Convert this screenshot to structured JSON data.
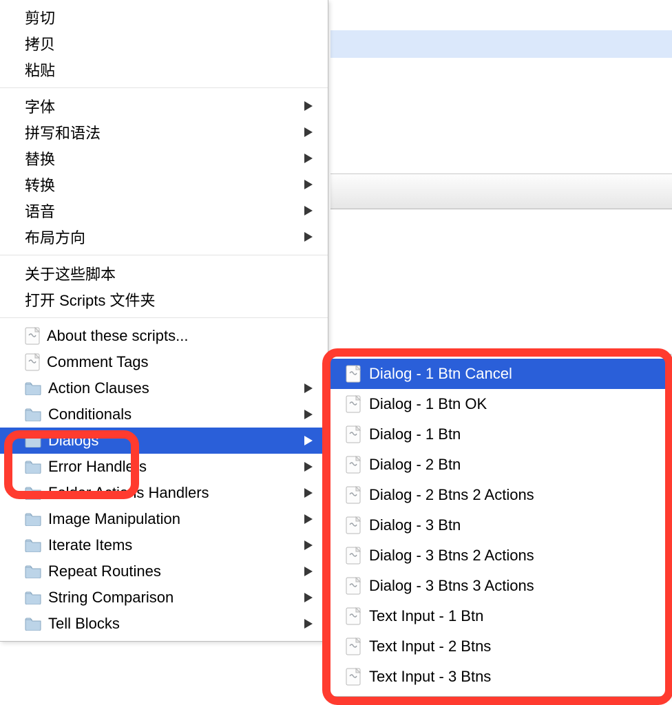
{
  "menu": {
    "group1": [
      {
        "label": "剪切"
      },
      {
        "label": "拷贝"
      },
      {
        "label": "粘贴"
      }
    ],
    "group2": [
      {
        "label": "字体"
      },
      {
        "label": "拼写和语法"
      },
      {
        "label": "替换"
      },
      {
        "label": "转换"
      },
      {
        "label": "语音"
      },
      {
        "label": "布局方向"
      }
    ],
    "group3": [
      {
        "label": "关于这些脚本"
      },
      {
        "label": "打开 Scripts 文件夹"
      }
    ],
    "group4": [
      {
        "label": "About these scripts...",
        "type": "script"
      },
      {
        "label": "Comment Tags",
        "type": "script"
      },
      {
        "label": "Action Clauses",
        "type": "folder"
      },
      {
        "label": "Conditionals",
        "type": "folder"
      },
      {
        "label": "Dialogs",
        "type": "folder",
        "selected": true
      },
      {
        "label": "Error Handlers",
        "type": "folder"
      },
      {
        "label": "Folder Actions Handlers",
        "type": "folder"
      },
      {
        "label": "Image Manipulation",
        "type": "folder"
      },
      {
        "label": "Iterate Items",
        "type": "folder"
      },
      {
        "label": "Repeat Routines",
        "type": "folder"
      },
      {
        "label": "String Comparison",
        "type": "folder"
      },
      {
        "label": "Tell Blocks",
        "type": "folder"
      }
    ]
  },
  "submenu": [
    {
      "label": "Dialog - 1 Btn Cancel",
      "selected": true
    },
    {
      "label": "Dialog - 1 Btn OK"
    },
    {
      "label": "Dialog - 1 Btn"
    },
    {
      "label": "Dialog - 2 Btn"
    },
    {
      "label": "Dialog - 2 Btns 2 Actions"
    },
    {
      "label": "Dialog - 3 Btn"
    },
    {
      "label": "Dialog - 3 Btns 2 Actions"
    },
    {
      "label": "Dialog - 3 Btns 3 Actions"
    },
    {
      "label": "Text Input - 1 Btn"
    },
    {
      "label": "Text Input - 2 Btns"
    },
    {
      "label": "Text Input - 3 Btns"
    }
  ]
}
